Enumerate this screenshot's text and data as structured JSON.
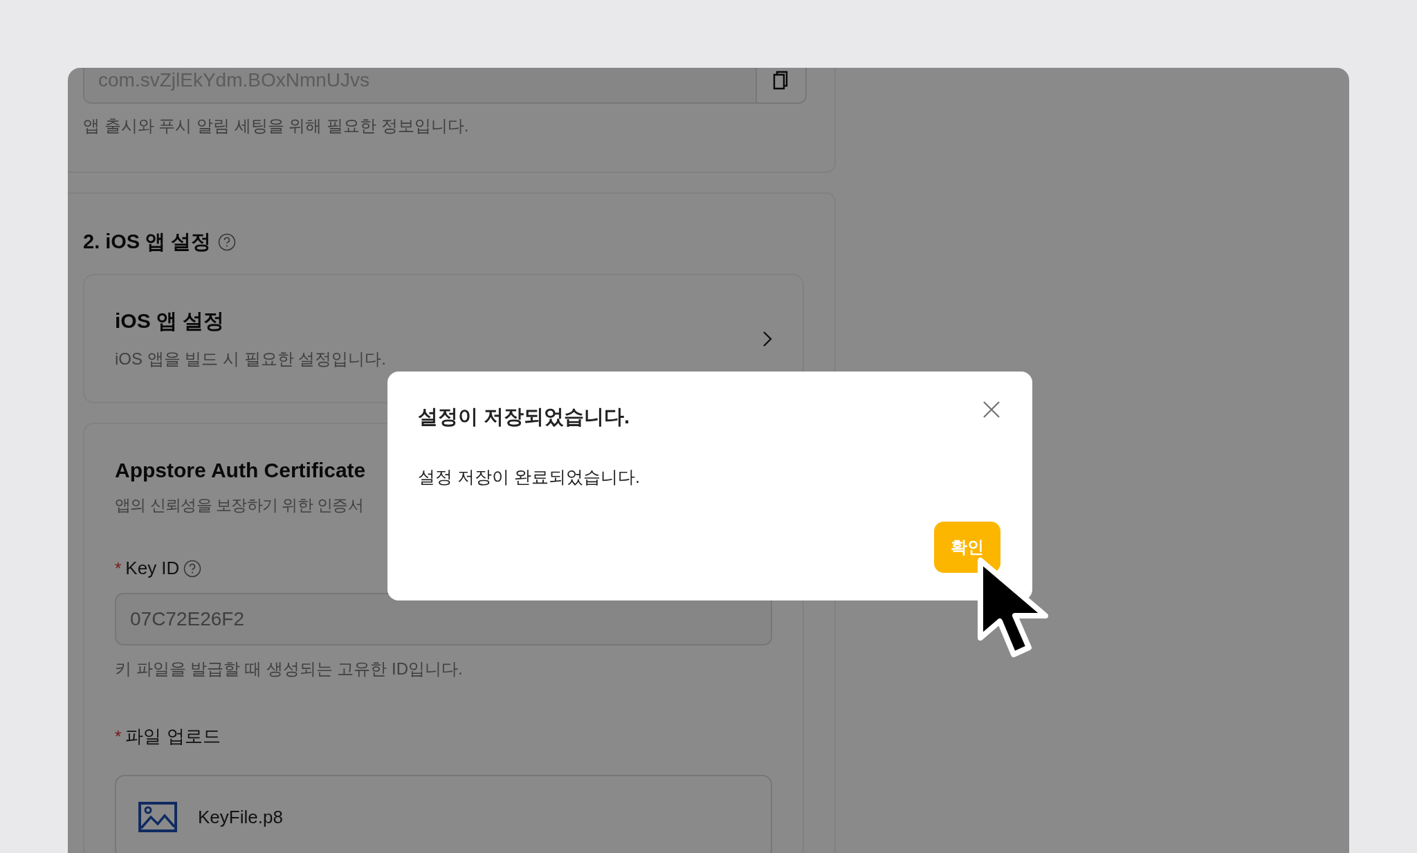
{
  "bundle_section": {
    "field_value": "com.svZjlEkYdm.BOxNmnUJvs",
    "help": "앱 출시와 푸시 알림 세팅을 위해 필요한 정보입니다."
  },
  "ios_section": {
    "title": "2. iOS 앱 설정",
    "settings_card": {
      "title": "iOS 앱 설정",
      "description": "iOS 앱을 빌드 시 필요한 설정입니다."
    },
    "certificate_card": {
      "title": "Appstore Auth Certificate",
      "description": "앱의 신뢰성을 보장하기 위한 인증서",
      "fields": [
        {
          "kind": "text",
          "label": "Key ID",
          "required_mark": "*",
          "has_help": true,
          "placeholder": "07C72E26F2",
          "help": "키 파일을 발급할 때 생성되는 고유한 ID입니다."
        },
        {
          "kind": "file",
          "label": "파일 업로드",
          "required_mark": "*",
          "has_help": false,
          "file_name": "KeyFile.p8"
        }
      ]
    }
  },
  "dialog": {
    "title": "설정이 저장되었습니다.",
    "message": "설정 저장이 완료되었습니다.",
    "confirm": "확인"
  }
}
